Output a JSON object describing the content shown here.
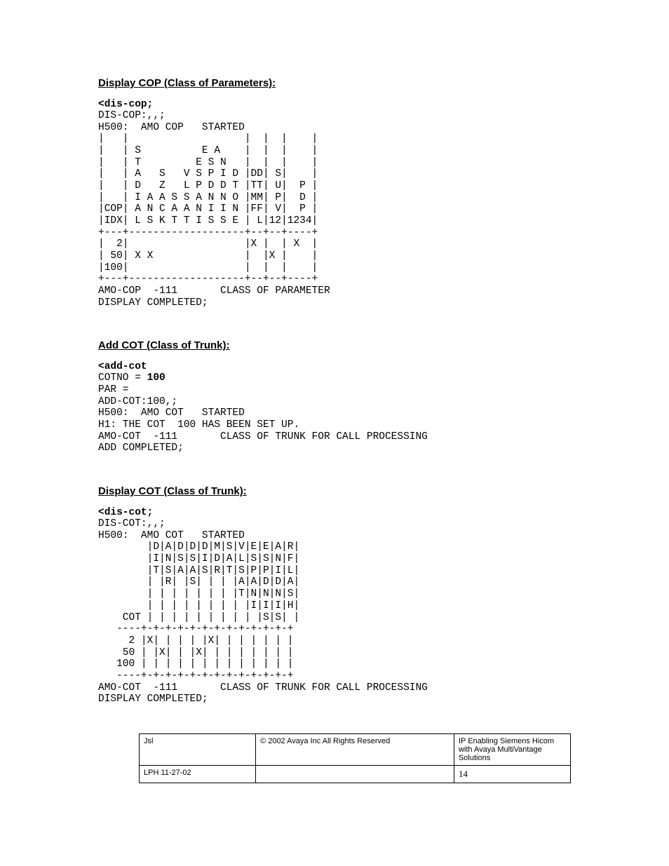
{
  "sections": {
    "dis_cop": {
      "heading": "Display COP (Class of Parameters):",
      "command": "<dis-cop;",
      "output": "DIS-COP:,,;\nH500:  AMO COP   STARTED\n|   |                   |  |  |    |\n|   | S          E A    |  |  |    |\n|   | T         E S N   |  |  |    |\n|   | A   S   V S P I D |DD| S|    |\n|   | D   Z   L P D D T |TT| U|  P |\n|   | I A A S S A N N O |MM| P|  D |\n|COP| A N C A A N I I N |FF| V|  P |\n|IDX| L S K T T I S S E | L|12|1234|\n+---+-------------------+--+--+----+\n|  2|                   |X |  | X  |\n| 50| X X               |  |X |    |\n|100|                   |  |  |    |\n+---+-------------------+--+--+----+\nAMO-COP  -111       CLASS OF PARAMETER\nDISPLAY COMPLETED;"
    },
    "add_cot": {
      "heading": "Add COT (Class of Trunk):",
      "command": "<add-cot",
      "cotno_label": "COTNO = ",
      "cotno_value": "100",
      "output": "PAR =\nADD-COT:100,;\nH500:  AMO COT   STARTED\nH1: THE COT  100 HAS BEEN SET UP.\nAMO-COT  -111       CLASS OF TRUNK FOR CALL PROCESSING\nADD COMPLETED;"
    },
    "dis_cot": {
      "heading": "Display COT (Class of Trunk):",
      "command": "<dis-cot;",
      "output": "DIS-COT:,,;\nH500:  AMO COT   STARTED\n        |D|A|D|D|D|M|S|V|E|E|A|R|\n        |I|N|S|S|I|D|A|L|S|S|N|F|\n        |T|S|A|A|S|R|T|S|P|P|I|L|\n        | |R| |S| | | |A|A|D|D|A|\n        | | | | | | | |T|N|N|N|S|\n        | | | | | | | | |I|I|I|H|\n    COT | | | | | | | | | |S|S| |\n   ----+-+-+-+-+-+-+-+-+-+-+-+-+\n     2 |X| | | | |X| | | | | | |\n    50 | |X| | |X| | | | | | | |\n   100 | | | | | | | | | | | | |\n   ----+-+-+-+-+-+-+-+-+-+-+-+-+\nAMO-COT  -111       CLASS OF TRUNK FOR CALL PROCESSING\nDISPLAY COMPLETED;"
    }
  },
  "footer": {
    "row1": {
      "left": "Jsl",
      "mid": "© 2002 Avaya Inc All Rights Reserved",
      "right": "IP Enabling Siemens Hicom with Avaya MultiVantage Solutions"
    },
    "row2": {
      "left": "LPH 11-27-02",
      "mid": "",
      "right": "14"
    }
  }
}
